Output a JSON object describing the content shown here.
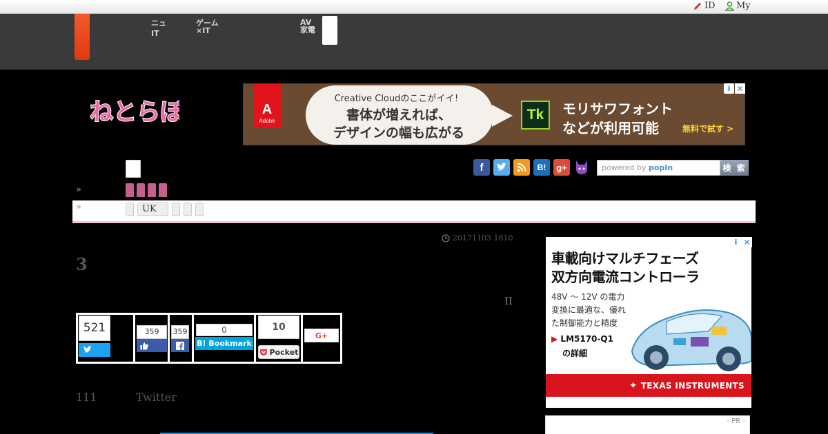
{
  "topbar": {
    "id_label": "ID",
    "my_label": "My"
  },
  "nav": {
    "item1_line1": "ニュ",
    "item1_line2": "IT",
    "item2_line1": "ゲーム",
    "item2_line2": "×IT",
    "item3_line1": "AV",
    "item3_line2": "家電"
  },
  "logo_text": "ねとらぼ",
  "ad_top": {
    "adobe_word": "Adobe",
    "cc_line": "Creative Cloudのここがイイ！",
    "big_line1": "書体が増えれば、",
    "big_line2": "デザインの幅も広がる",
    "tk": "Tk",
    "right_line1": "モリサワフォント",
    "right_line2": "などが利用可能",
    "cta": "無料で試す >"
  },
  "subnav": {
    "tab_uk": "UK"
  },
  "search": {
    "placeholder_prefix": "powered by ",
    "placeholder_brand": "popIn",
    "button": "検 索"
  },
  "article": {
    "timestamp": "20171103 1810",
    "title": "3",
    "ii": "II",
    "body_num": "111",
    "body_twitter": "Twitter"
  },
  "share": {
    "twitter_count": "521",
    "like_count": "359",
    "fb_count": "359",
    "hatena_count": "0",
    "hatena_label": "B! Bookmark",
    "pocket_count": "10",
    "pocket_label": "Pocket",
    "gplus_label": "G+"
  },
  "ad_side": {
    "h1": "車載向けマルチフェーズ",
    "h2": "双方向電流コントローラ",
    "s1": "48V ～ 12V の電力",
    "s2": "変換に最適な、優れ",
    "s3": "た制御能力と精度",
    "link1": "LM5170-Q1",
    "link2": "の詳細",
    "brand": "TEXAS INSTRUMENTS"
  },
  "pr_label": "- PR -",
  "colors": {
    "nav_bg": "#3a3a3a",
    "accent_orange": "#e8441a",
    "pink": "#c8608e",
    "twitter": "#1da1f2",
    "facebook": "#3b5ca8",
    "hatena": "#00a4de",
    "ti_red": "#d8141d"
  }
}
